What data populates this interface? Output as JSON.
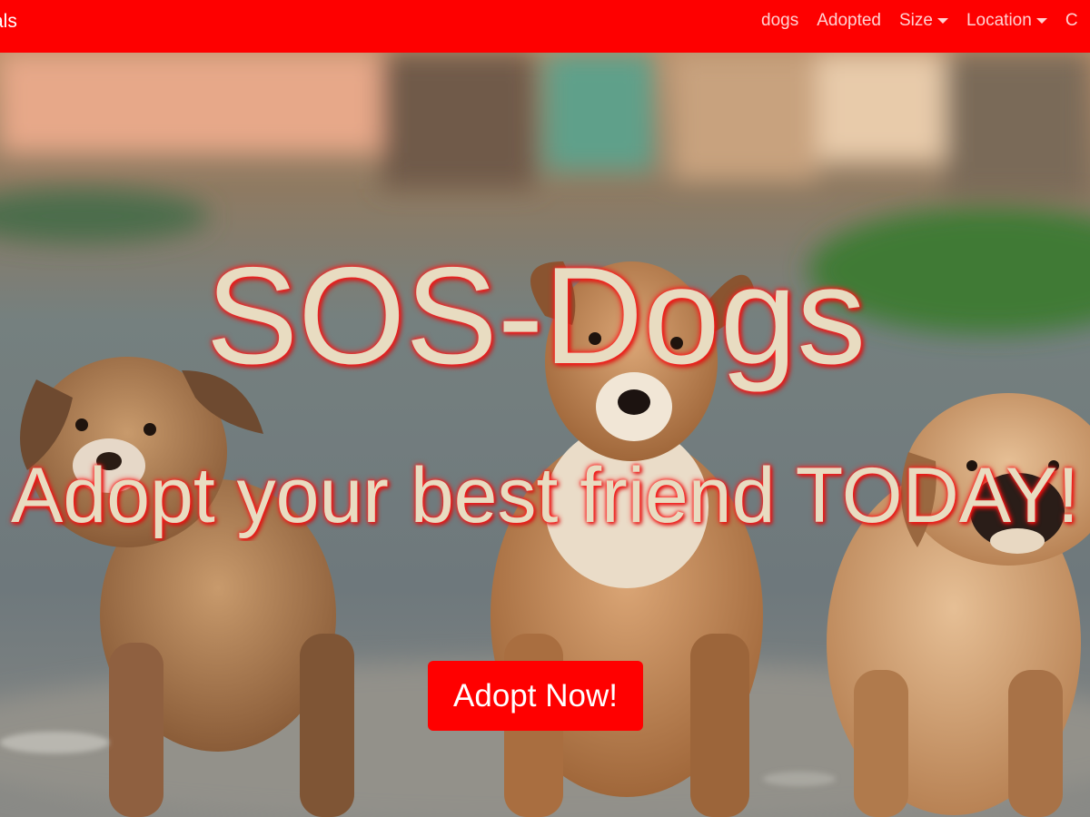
{
  "navbar": {
    "brand": "als",
    "items": [
      {
        "label": "dogs",
        "dropdown": false
      },
      {
        "label": "Adopted",
        "dropdown": false
      },
      {
        "label": "Size",
        "dropdown": true
      },
      {
        "label": "Location",
        "dropdown": true
      },
      {
        "label": "C",
        "dropdown": false
      }
    ]
  },
  "hero": {
    "title": "SOS-Dogs",
    "subtitle": "Adopt your best friend TODAY!",
    "cta_label": "Adopt Now!"
  },
  "colors": {
    "navbar": "#fe0000",
    "button": "#ff0000",
    "hero_text": "#e8dcc1",
    "text_glow": "#ff2020"
  }
}
